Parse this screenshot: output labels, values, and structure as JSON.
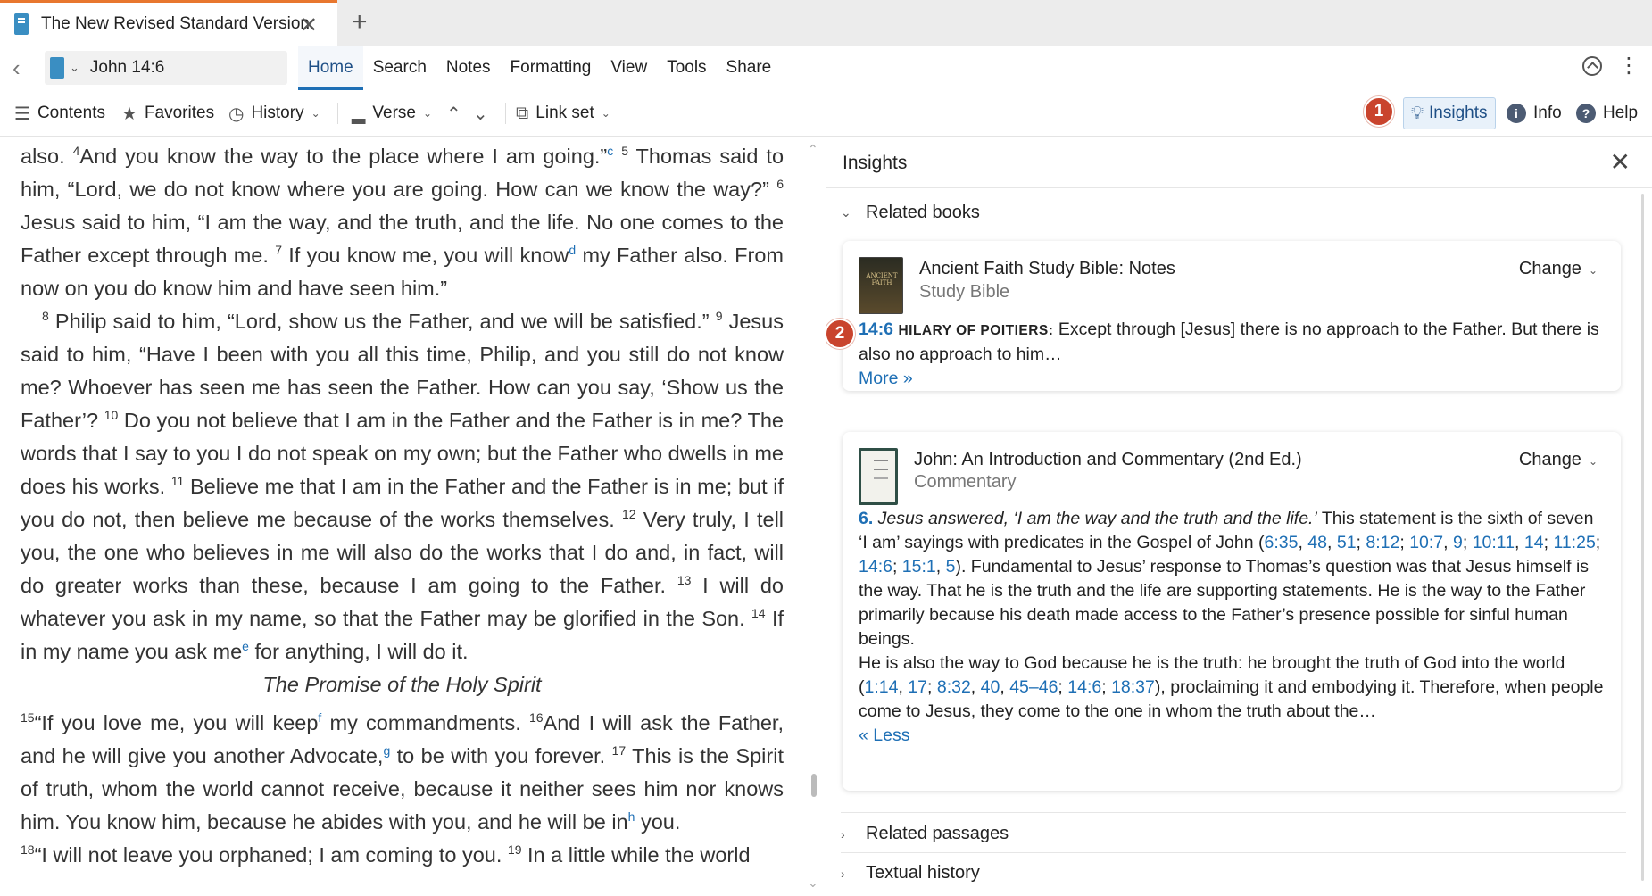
{
  "tab": {
    "title": "The New Revised Standard Version",
    "close": "✕",
    "new": "+"
  },
  "nav": {
    "reference": "John 14:6",
    "menu": [
      "Home",
      "Search",
      "Notes",
      "Formatting",
      "View",
      "Tools",
      "Share"
    ],
    "active": "Home"
  },
  "toolbar": {
    "contents": "Contents",
    "favorites": "Favorites",
    "history": "History",
    "verse": "Verse",
    "linkset": "Link set",
    "insights": "Insights",
    "info": "Info",
    "help": "Help",
    "badge1": "1",
    "badge2": "2"
  },
  "reader": {
    "p1": [
      {
        "t": "also. "
      },
      {
        "v": "4"
      },
      {
        "t": "And you know the way to the place where I am going.”"
      },
      {
        "f": "c"
      },
      {
        "t": " "
      },
      {
        "v": "5"
      },
      {
        "t": " Thomas said to him, “Lord, we do not know where you are going. How can we know the way?” "
      },
      {
        "v": "6"
      },
      {
        "t": " Jesus said to him, “I am the way, and the truth, and the life. No one comes to the Father except through me. "
      },
      {
        "v": "7"
      },
      {
        "t": " If you know me, you will know"
      },
      {
        "f": "d"
      },
      {
        "t": " my Father also. From now on you do know him and have seen him.”"
      }
    ],
    "p2": [
      {
        "v": "8"
      },
      {
        "t": " Philip said to him, “Lord, show us the Father, and we will be satisfied.” "
      },
      {
        "v": "9"
      },
      {
        "t": " Jesus said to him, “Have I been with you all this time, Philip, and you still do not know me? Whoever has seen me has seen the Father. How can you say, ‘Show us the Father’? "
      },
      {
        "v": "10"
      },
      {
        "t": " Do you not believe that I am in the Father and the Father is in me? The words that I say to you I do not speak on my own; but the Father who dwells in me does his works. "
      },
      {
        "v": "11"
      },
      {
        "t": " Believe me that I am in the Father and the Father is in me; but if you do not, then believe me because of the works themselves. "
      },
      {
        "v": "12"
      },
      {
        "t": " Very truly, I tell you, the one who believes in me will also do the works that I do and, in fact, will do greater works than these, because I am going to the Father. "
      },
      {
        "v": "13"
      },
      {
        "t": " I will do whatever you ask in my name, so that the Father may be glorified in the Son. "
      },
      {
        "v": "14"
      },
      {
        "t": " If in my name you ask me"
      },
      {
        "f": "e"
      },
      {
        "t": " for anything, I will do it."
      }
    ],
    "heading": "The Promise of the Holy Spirit",
    "p3": [
      {
        "v": "15"
      },
      {
        "t": "“If you love me, you will keep"
      },
      {
        "f": "f"
      },
      {
        "t": " my commandments. "
      },
      {
        "v": "16"
      },
      {
        "t": "And I will ask the Father, and he will give you another Advocate,"
      },
      {
        "f": "g"
      },
      {
        "t": " to be with you forever. "
      },
      {
        "v": "17"
      },
      {
        "t": " This is the Spirit of truth, whom the world cannot receive, because it neither sees him nor knows him. You know him, because he abides with you, and he will be in"
      },
      {
        "f": "h"
      },
      {
        "t": " you."
      }
    ],
    "p4": [
      {
        "v": "18"
      },
      {
        "t": "“I will not leave you orphaned; I am coming to you. "
      },
      {
        "v": "19"
      },
      {
        "t": " In a little while the world"
      }
    ]
  },
  "insights": {
    "title": "Insights",
    "close": "✕",
    "section_related_books": "Related books",
    "section_related_passages": "Related passages",
    "section_textual_history": "Textual history",
    "card1": {
      "title": "Ancient Faith Study Bible: Notes",
      "subtitle": "Study Bible",
      "change": "Change",
      "ref": "14:6",
      "author": "HILARY OF POITIERS:",
      "text": " Except through [Jesus] there is no approach to the Father. But there is also no approach to him…",
      "more": "More »"
    },
    "card2": {
      "title": "John: An Introduction and Commentary (2nd Ed.)",
      "subtitle": "Commentary",
      "change": "Change",
      "body": [
        {
          "b": "6."
        },
        {
          "i": " Jesus answered, ‘I am the way and the truth and the life.’"
        },
        {
          "t": " This statement is the sixth of seven ‘I am’ sayings with predicates in the Gospel of John ("
        },
        {
          "l": "6:35"
        },
        {
          "t": ", "
        },
        {
          "l": "48"
        },
        {
          "t": ", "
        },
        {
          "l": "51"
        },
        {
          "t": "; "
        },
        {
          "l": "8:12"
        },
        {
          "t": "; "
        },
        {
          "l": "10:7"
        },
        {
          "t": ", "
        },
        {
          "l": "9"
        },
        {
          "t": "; "
        },
        {
          "l": "10:11"
        },
        {
          "t": ", "
        },
        {
          "l": "14"
        },
        {
          "t": "; "
        },
        {
          "l": "11:25"
        },
        {
          "t": "; "
        },
        {
          "l": "14:6"
        },
        {
          "t": "; "
        },
        {
          "l": "15:1"
        },
        {
          "t": ", "
        },
        {
          "l": "5"
        },
        {
          "t": "). Fundamental to Jesus’ response to Thomas’s question was that Jesus himself is the way. That he is the truth and the life are supporting statements. He is the way to the Father primarily because his death made access to the Father’s presence possible for sinful human beings."
        },
        {
          "br": ""
        },
        {
          "t": "He is also the way to God because he is the truth: he brought the truth of God into the world ("
        },
        {
          "l": "1:14"
        },
        {
          "t": ", "
        },
        {
          "l": "17"
        },
        {
          "t": "; "
        },
        {
          "l": "8:32"
        },
        {
          "t": ", "
        },
        {
          "l": "40"
        },
        {
          "t": ", "
        },
        {
          "l": "45–46"
        },
        {
          "t": "; "
        },
        {
          "l": "14:6"
        },
        {
          "t": "; "
        },
        {
          "l": "18:37"
        },
        {
          "t": "), proclaiming it and embodying it. Therefore, when people come to Jesus, they come to the one in whom the truth about the…"
        }
      ],
      "less": "« Less"
    }
  }
}
